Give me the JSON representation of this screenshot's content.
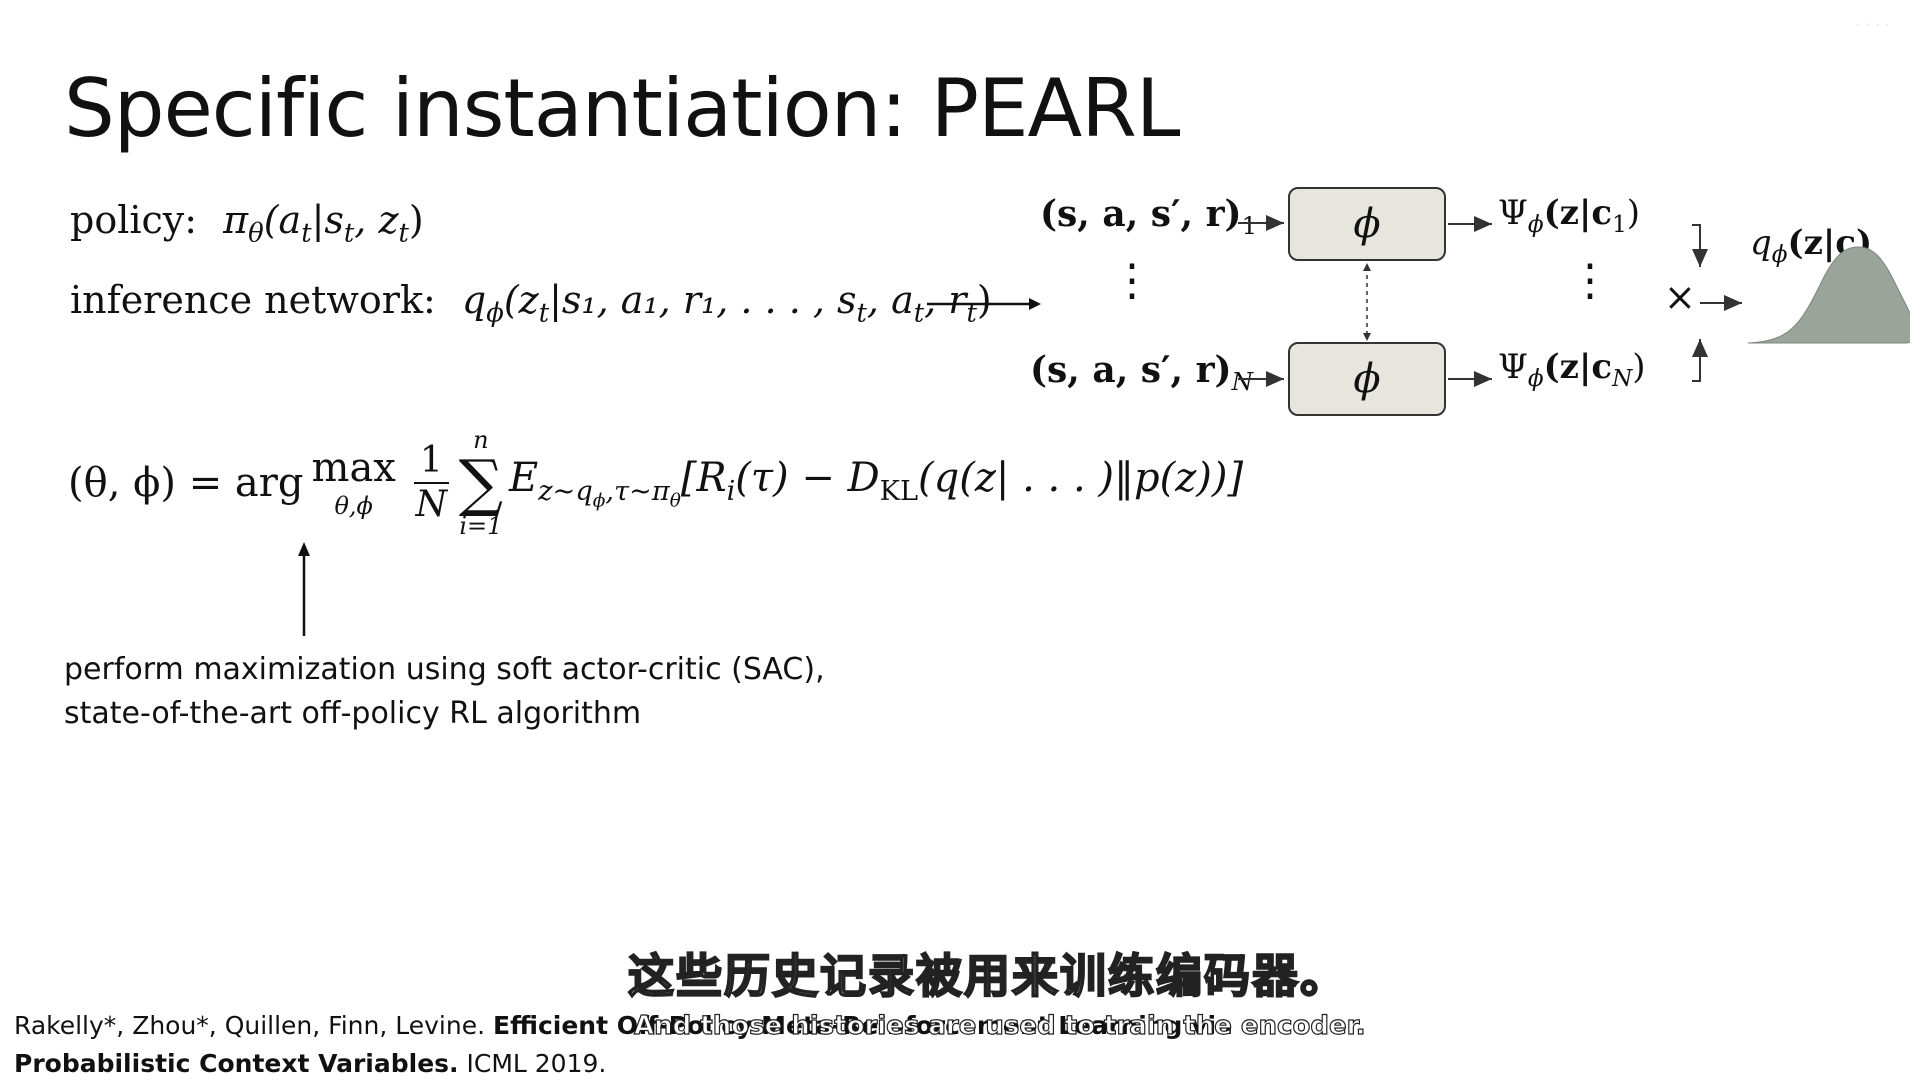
{
  "slide": {
    "title": "Specific instantiation: PEARL",
    "watermark": "· · · ·"
  },
  "equations": {
    "policy": {
      "label": "policy:",
      "pi": "π",
      "theta": "θ",
      "args": "(a",
      "t_sub": "t",
      "bar_s": "|s",
      "comma_z": ", z",
      "close": ")"
    },
    "inference": {
      "label": "inference network:",
      "expr": "q",
      "phi": "ϕ",
      "body_open": "(z",
      "body_rest": "|s₁, a₁, r₁, . . . , s",
      "body_tail_a": ", a",
      "body_tail_r": ", r",
      "close": ")"
    },
    "objective": {
      "lhs": "(θ, ϕ) = arg",
      "max": "max",
      "max_under": "θ,ϕ",
      "frac_num": "1",
      "frac_den": "N",
      "sum_over": "n",
      "sum_sym": "∑",
      "sum_under": "i=1",
      "expectation": "E",
      "expectation_sub": "z∼q",
      "expectation_sub_phi": "ϕ",
      "expectation_sub_rest": ",τ∼π",
      "expectation_sub_theta": "θ",
      "body": "[R",
      "body_i": "i",
      "body_mid": "(τ) − D",
      "kl": "KL",
      "body_end": "(q(z| . . . )‖p(z))]"
    }
  },
  "note": {
    "line1": "perform maximization using soft actor-critic (SAC),",
    "line2": "state-of-the-art off-policy RL algorithm"
  },
  "diagram": {
    "input_top": "(s, a, s′, r)",
    "input_top_sub": "1",
    "input_bottom": "(s, a, s′, r)",
    "input_bottom_sub": "N",
    "encoder_symbol": "ϕ",
    "vdots": "⋮",
    "factor_top": "Ψ",
    "factor_top_body": "(z|c",
    "factor_top_sub": "1",
    "factor_bottom": "Ψ",
    "factor_bottom_body": "(z|c",
    "factor_bottom_sub": "N",
    "factor_phi": "ϕ",
    "close_paren": ")",
    "product": "×",
    "posterior": "q",
    "posterior_phi": "ϕ",
    "posterior_body": "(z|c)"
  },
  "citation": {
    "authors": "Rakelly*, Zhou*, Quillen, Finn, Levine. ",
    "title_start": "Efficient Off-Policy Meta-Reinforcement Learning via",
    "title_end": "Probabilistic Context Variables.",
    "venue": " ICML 2019."
  },
  "subtitles": {
    "zh": "这些历史记录被用来训练编码器。",
    "en": "And those histories are used to train the encoder."
  }
}
